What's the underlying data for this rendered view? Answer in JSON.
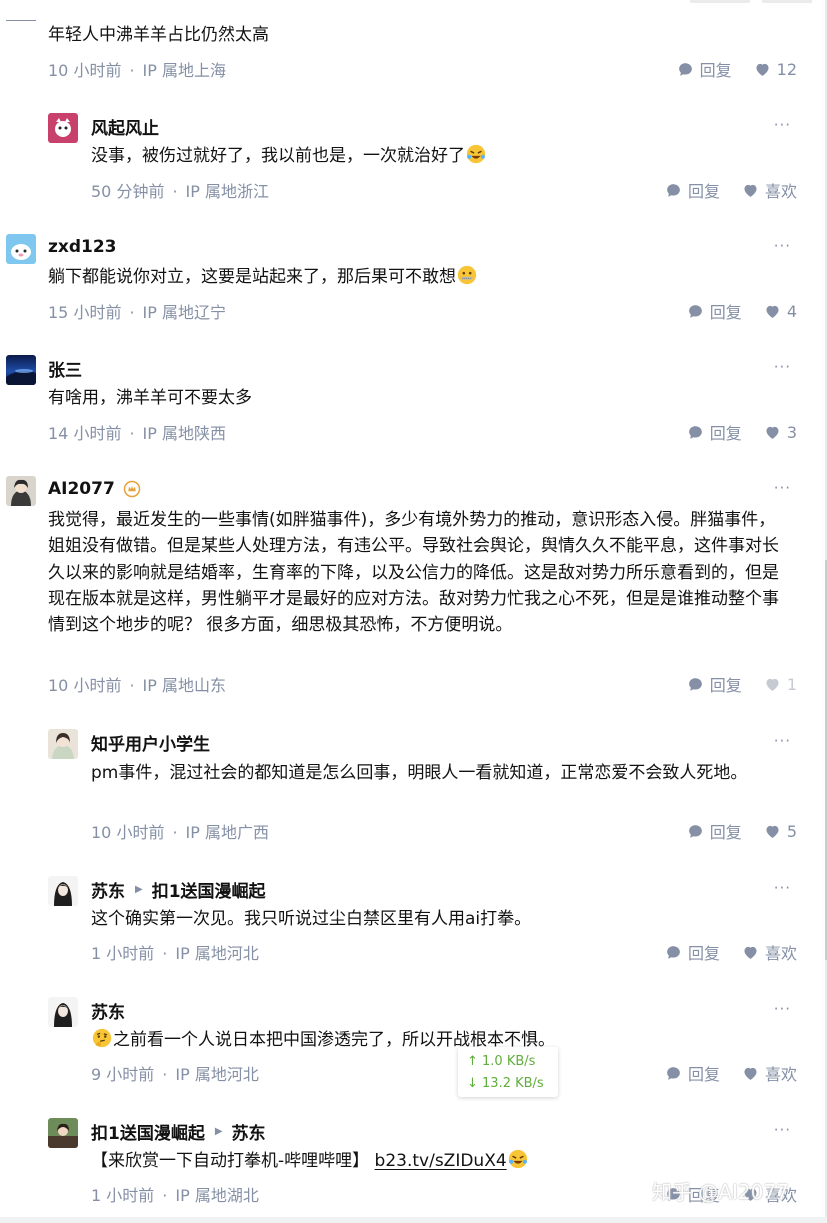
{
  "labels": {
    "reply": "回复",
    "like": "喜欢",
    "more": "···",
    "meta_sep": "·"
  },
  "colors": {
    "text": "#121212",
    "meta": "#8590a6",
    "speed": "#5fae3b",
    "badge": "#e6a23c"
  },
  "comments": [
    {
      "author": "",
      "text": "年轻人中沸羊羊占比仍然太高",
      "time": "10 小时前",
      "ip": "IP 属地上海",
      "likes": "12"
    },
    {
      "author": "风起风止",
      "text_before": "没事，被伤过就好了，我以前也是，一次就治好了",
      "emoji": "rofl-emoji",
      "time": "50 分钟前",
      "ip": "IP 属地浙江",
      "likes": "喜欢"
    },
    {
      "author": "zxd123",
      "text_before": "躺下都能说你对立，这要是站起来了，那后果可不敢想",
      "emoji": "zipper-mouth-emoji",
      "time": "15 小时前",
      "ip": "IP 属地辽宁",
      "likes": "4"
    },
    {
      "author": "张三",
      "text": "有啥用，沸羊羊可不要太多",
      "time": "14 小时前",
      "ip": "IP 属地陕西",
      "likes": "3"
    },
    {
      "author": "AI2077",
      "text": "我觉得，最近发生的一些事情(如胖猫事件)，多少有境外势力的推动，意识形态入侵。胖猫事件，姐姐没有做错。但是某些人处理方法，有违公平。导致社会舆论，舆情久久不能平息，这件事对长久以来的影响就是结婚率，生育率的下降，以及公信力的降低。这是敌对势力所乐意看到的，但是现在版本就是这样，男性躺平才是最好的应对方法。敌对势力忙我之心不死，但是是谁推动整个事情到这个地步的呢？ 很多方面，细思极其恐怖，不方便明说。",
      "time": "10 小时前",
      "ip": "IP 属地山东",
      "likes": "1"
    },
    {
      "author": "知乎用户小学生",
      "text": "pm事件，混过社会的都知道是怎么回事，明眼人一看就知道，正常恋爱不会致人死地。",
      "time": "10 小时前",
      "ip": "IP 属地广西",
      "likes": "5"
    },
    {
      "author": "苏东",
      "reply_to": "扣1送国漫崛起",
      "text": "这个确实第一次见。我只听说过尘白禁区里有人用ai打拳。",
      "time": "1 小时前",
      "ip": "IP 属地河北",
      "likes": "喜欢"
    },
    {
      "author": "苏东",
      "emoji": "thinking-emoji",
      "text_after": "之前看一个人说日本把中国渗透完了，所以开战根本不惧。",
      "time": "9 小时前",
      "ip": "IP 属地河北",
      "likes": "喜欢"
    },
    {
      "author": "扣1送国漫崛起",
      "reply_to": "苏东",
      "text_before": "【来欣赏一下自动打拳机-哔哩哔哩】 ",
      "link": "b23.tv/sZIDuX4",
      "emoji": "rofl-emoji",
      "time": "1 小时前",
      "ip": "IP 属地湖北",
      "likes": "喜欢"
    }
  ],
  "net_speed": {
    "up": "↑ 1.0 KB/s",
    "down": "↓ 13.2 KB/s"
  },
  "watermark": "知乎 @AI2077"
}
